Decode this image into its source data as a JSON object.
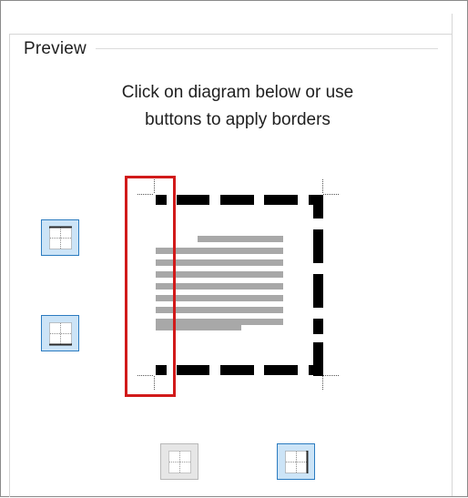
{
  "preview": {
    "title": "Preview",
    "instruction_line1": "Click on diagram below or use",
    "instruction_line2": "buttons to apply borders"
  },
  "buttons": [
    {
      "name": "top-border-button",
      "state": "pressed"
    },
    {
      "name": "bottom-border-button",
      "state": "pressed"
    },
    {
      "name": "left-border-button",
      "state": "disabled"
    },
    {
      "name": "right-border-button",
      "state": "pressed"
    }
  ],
  "colors": {
    "pressed_fill": "#cce4f7",
    "pressed_border": "#2b7bc0",
    "highlight": "#d11a1a",
    "text_lines": "#a8a8a8",
    "border_stroke": "#000000"
  }
}
